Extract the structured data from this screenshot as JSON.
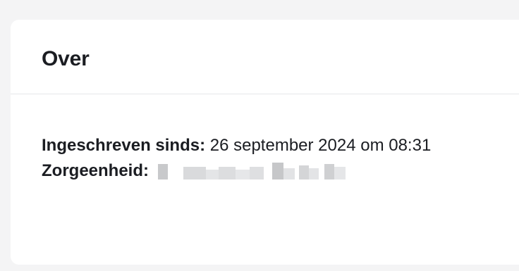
{
  "card": {
    "title": "Over",
    "rows": [
      {
        "label": "Ingeschreven sinds:",
        "value": "26 september 2024 om 08:31"
      },
      {
        "label": "Zorgeenheid:",
        "value": ""
      }
    ]
  },
  "colors": {
    "background": "#f4f4f5",
    "card": "#ffffff",
    "divider": "#e6e7ea",
    "text": "#1b1d22",
    "redaction": "#d9dadc"
  }
}
